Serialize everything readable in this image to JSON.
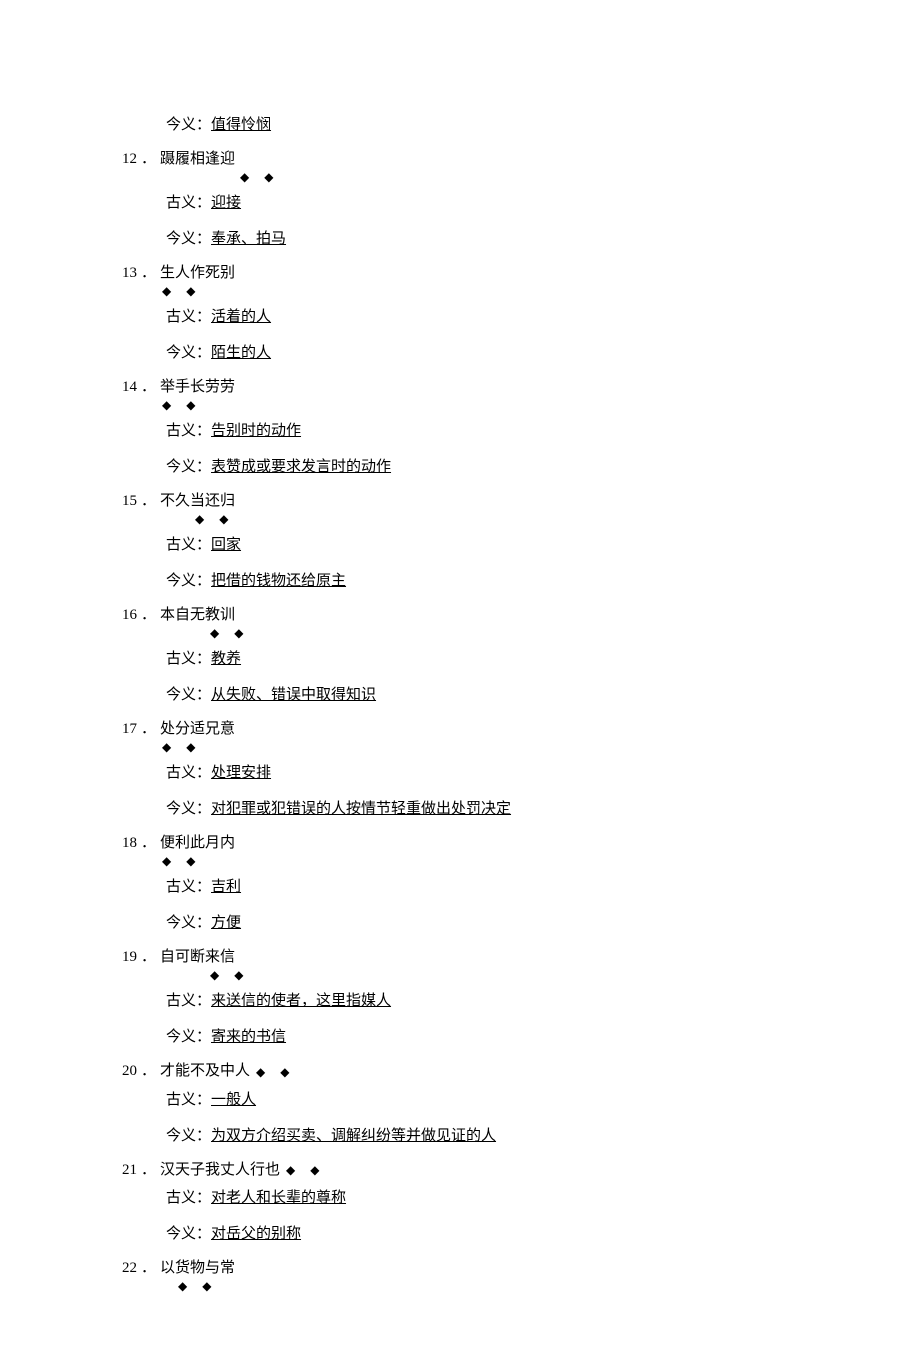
{
  "labels": {
    "ancient": "古义：",
    "modern": "今义：",
    "dot": "．"
  },
  "diamonds": "◆ ◆",
  "lead": {
    "modern": "值得怜悯"
  },
  "items": [
    {
      "num": "12",
      "title": "蹑履相逢迎",
      "diamond_indent": 240,
      "ancient": "迎接",
      "modern": "奉承、拍马"
    },
    {
      "num": "13",
      "title": "生人作死别",
      "diamond_indent": 162,
      "ancient": "活着的人",
      "modern": "陌生的人"
    },
    {
      "num": "14",
      "title": "举手长劳劳",
      "diamond_indent": 162,
      "ancient": "告别时的动作",
      "modern": "表赞成或要求发言时的动作"
    },
    {
      "num": "15",
      "title": "不久当还归",
      "diamond_indent": 195,
      "ancient": "回家",
      "modern": "把借的钱物还给原主"
    },
    {
      "num": "16",
      "title": "本自无教训",
      "diamond_indent": 210,
      "ancient": "教养",
      "modern": "从失败、错误中取得知识"
    },
    {
      "num": "17",
      "title": "处分适兄意",
      "diamond_indent": 162,
      "ancient": "处理安排",
      "modern": "对犯罪或犯错误的人按情节轻重做出处罚决定"
    },
    {
      "num": "18",
      "title": "便利此月内",
      "diamond_indent": 162,
      "ancient": "吉利",
      "modern": "方便"
    },
    {
      "num": "19",
      "title": "自可断来信",
      "diamond_indent": 210,
      "ancient": "来送信的使者，这里指媒人",
      "modern": "寄来的书信"
    },
    {
      "num": "20",
      "title": "才能不及中人",
      "inline_diamond": true,
      "ancient": "一般人",
      "modern": "为双方介绍买卖、调解纠纷等并做见证的人"
    },
    {
      "num": "21",
      "title": "汉天子我丈人行也",
      "inline_diamond": true,
      "ancient": "对老人和长辈的尊称",
      "modern": "对岳父的别称"
    },
    {
      "num": "22",
      "title": "以货物与常",
      "diamond_indent": 178,
      "trailing_only": true
    }
  ]
}
